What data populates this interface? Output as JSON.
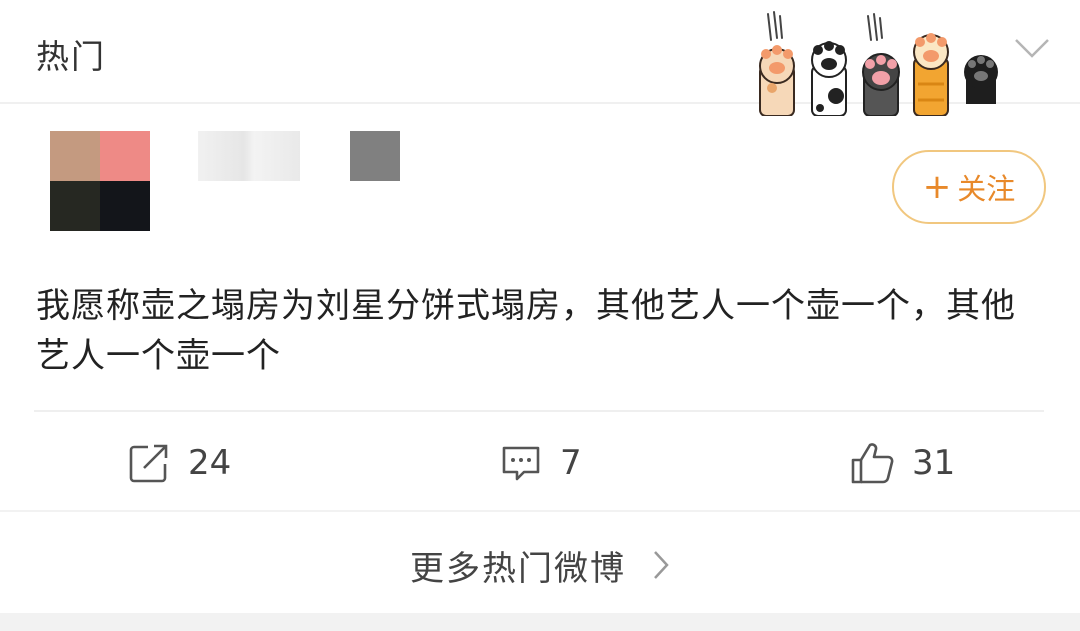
{
  "section": {
    "title": "热门"
  },
  "follow": {
    "plus": "+",
    "label": "关注"
  },
  "post": {
    "text": "我愿称壶之塌房为刘星分饼式塌房，其他艺人一个壶一个，其他艺人一个壶一个"
  },
  "actions": {
    "repost_count": "24",
    "comment_count": "7",
    "like_count": "31"
  },
  "footer": {
    "more_label": "更多热门微博"
  },
  "avatar_colors": [
    "#c49a80",
    "#ee8a86",
    "#262822",
    "#13151a"
  ],
  "icons": [
    "paw-decoration-icon",
    "chevron-down-icon",
    "repost-icon",
    "comment-icon",
    "like-icon",
    "chevron-right-icon"
  ],
  "colors": {
    "accent": "#e8892a",
    "follow_border": "#f1c77f"
  }
}
